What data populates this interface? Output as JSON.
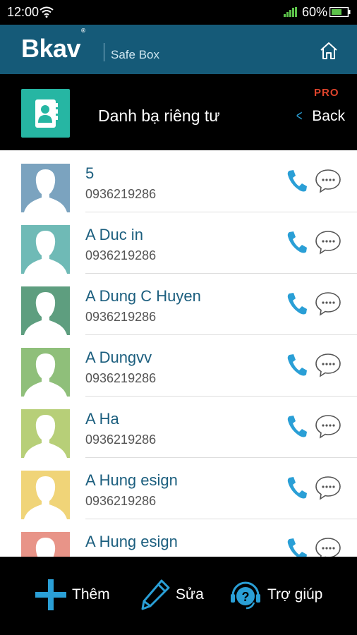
{
  "status_bar": {
    "time": "12:00",
    "battery_percent": "60%",
    "icons": [
      "wifi-icon",
      "signal-icon",
      "battery-icon"
    ]
  },
  "app_header": {
    "brand": "Bkav",
    "registered_mark": "®",
    "subtitle": "Safe Box",
    "home_icon": "home-icon"
  },
  "section": {
    "icon": "contacts-book-icon",
    "title": "Danh bạ riêng tư",
    "badge": "PRO",
    "back_label": "Back",
    "back_icon": "chevron-left-icon"
  },
  "contacts": [
    {
      "name": "5",
      "phone": "0936219286",
      "avatar_color": "#7ba3bf"
    },
    {
      "name": "A Duc in",
      "phone": "0936219286",
      "avatar_color": "#6fbab6"
    },
    {
      "name": "A Dung C Huyen",
      "phone": "0936219286",
      "avatar_color": "#5e9e7f"
    },
    {
      "name": "A Dungvv",
      "phone": "0936219286",
      "avatar_color": "#8fbf7a"
    },
    {
      "name": "A Ha",
      "phone": "0936219286",
      "avatar_color": "#b7cf78"
    },
    {
      "name": "A Hung esign",
      "phone": "0936219286",
      "avatar_color": "#f0d478"
    },
    {
      "name": "A Hung esign",
      "phone": "",
      "avatar_color": "#e89488"
    }
  ],
  "row_actions": {
    "call_icon": "phone-call-icon",
    "message_icon": "chat-bubble-icon"
  },
  "bottom_bar": {
    "add_label": "Thêm",
    "edit_label": "Sửa",
    "help_label": "Trợ giúp",
    "icons": [
      "plus-icon",
      "pencil-icon",
      "help-headset-icon"
    ]
  },
  "colors": {
    "header_bg": "#155a78",
    "accent_blue": "#2a9fd6",
    "name_text": "#1b5e7e",
    "pro_red": "#e0442c",
    "section_icon_bg": "#26b6a3"
  }
}
